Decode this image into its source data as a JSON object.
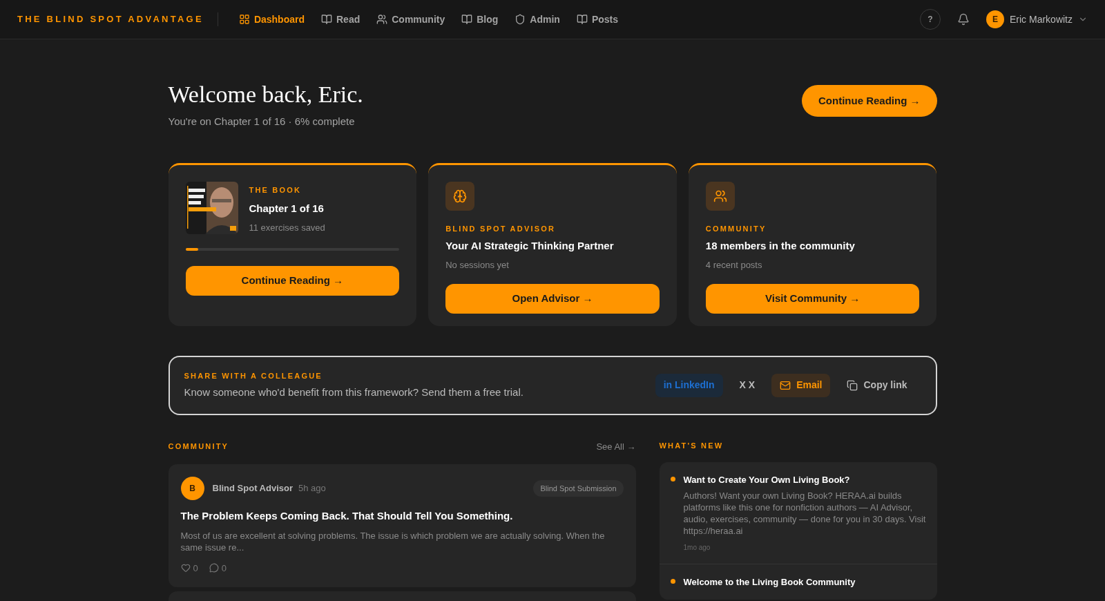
{
  "brand": "THE BLIND SPOT ADVANTAGE",
  "nav": [
    {
      "label": "Dashboard",
      "selected": true
    },
    {
      "label": "Read",
      "selected": false
    },
    {
      "label": "Community",
      "selected": false
    },
    {
      "label": "Blog",
      "selected": false
    },
    {
      "label": "Admin",
      "selected": false
    },
    {
      "label": "Posts",
      "selected": false
    }
  ],
  "help": "?",
  "user": {
    "initial": "E",
    "name": "Eric Markowitz"
  },
  "welcome": {
    "title": "Welcome back, Eric.",
    "subtitle": "You're on Chapter 1 of 16 · 6% complete",
    "button": "Continue Reading →"
  },
  "cards": [
    {
      "kind": "book",
      "eyebrow": "THE BOOK",
      "title": "Chapter 1 of 16",
      "subtitle": "11 exercises saved",
      "level": 0.06,
      "button": "Continue Reading →"
    },
    {
      "kind": "advisor",
      "eyebrow": "BLIND SPOT ADVISOR",
      "title": "Your AI Strategic Thinking Partner",
      "subtitle": "No sessions yet",
      "button": "Open Advisor →"
    },
    {
      "kind": "community",
      "eyebrow": "COMMUNITY",
      "title": "18 members in the community",
      "subtitle": "4 recent posts",
      "button": "Visit Community →"
    }
  ],
  "share": {
    "eyebrow": "SHARE WITH A COLLEAGUE",
    "text": "Know someone who'd benefit from this framework? Send them a free trial.",
    "buttons": [
      {
        "kind": "linkedin",
        "label": "in LinkedIn"
      },
      {
        "kind": "x",
        "label": "X X"
      },
      {
        "kind": "email",
        "label": "Email"
      },
      {
        "kind": "copy",
        "label": "Copy link"
      }
    ]
  },
  "community": {
    "heading": "COMMUNITY",
    "see_all": "See All →",
    "posts": [
      {
        "initial": "B",
        "author": "Blind Spot Advisor",
        "time": "5h ago",
        "tag": "Blind Spot Submission",
        "title": "The Problem Keeps Coming Back. That Should Tell You Something.",
        "excerpt": "Most of us are excellent at solving problems. The issue is which problem we are actually solving. When the same issue re...",
        "likes": "0",
        "comments": "0"
      }
    ]
  },
  "whats_new": {
    "heading": "WHAT'S NEW",
    "items": [
      {
        "title": "Want to Create Your Own Living Book?",
        "body": "Authors! Want your own Living Book? HERAA.ai builds platforms like this one for nonfiction authors — AI Advisor, audio, exercises, community — done for you in 30 days. Visit https://heraa.ai",
        "time": "1mo ago"
      },
      {
        "title": "Welcome to the Living Book Community"
      }
    ]
  }
}
